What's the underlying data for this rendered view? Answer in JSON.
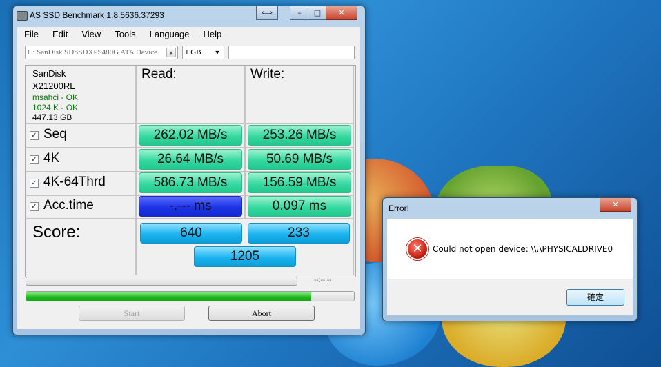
{
  "main_window": {
    "title": "AS SSD Benchmark 1.8.5636.37293",
    "caption": {
      "resize": "⟺",
      "minimize": "–",
      "maximize": "□",
      "close": "✕"
    },
    "menu": [
      "File",
      "Edit",
      "View",
      "Tools",
      "Language",
      "Help"
    ],
    "device_select": "C: SanDisk SDSSDXPS480G ATA Device",
    "size_select": "1 GB",
    "extra_field": "",
    "drive_info": {
      "vendor": "SanDisk",
      "firmware": "X21200RL",
      "driver": "msahci - OK",
      "alignment": "1024 K - OK",
      "capacity": "447.13 GB"
    },
    "headers": {
      "read": "Read:",
      "write": "Write:"
    },
    "rows": [
      {
        "label": "Seq",
        "checked": "✓",
        "read": "262.02 MB/s",
        "write": "253.26 MB/s"
      },
      {
        "label": "4K",
        "checked": "✓",
        "read": "26.64 MB/s",
        "write": "50.69 MB/s"
      },
      {
        "label": "4K-64Thrd",
        "checked": "✓",
        "read": "586.73 MB/s",
        "write": "156.59 MB/s"
      },
      {
        "label": "Acc.time",
        "checked": "✓",
        "read": "-.--- ms",
        "write": "0.097 ms"
      }
    ],
    "score": {
      "label": "Score:",
      "read": "640",
      "write": "233",
      "total": "1205"
    },
    "progress": {
      "top_fraction": 0.0,
      "time": "--:--:--",
      "bottom_fraction": 0.87
    },
    "buttons": {
      "start": "Start",
      "abort": "Abort"
    }
  },
  "error_dialog": {
    "title": "Error!",
    "close": "✕",
    "icon": "error-icon",
    "icon_glyph": "✕",
    "message": "Could not open device: \\\\.\\PHYSICALDRIVE0",
    "ok_button": "確定"
  },
  "colors": {
    "value_green": "#36d9a1",
    "value_blue": "#1b34e6",
    "score_cyan": "#1cb3ef",
    "progress_green": "#20b620",
    "info_green": "#0a7a0a"
  }
}
